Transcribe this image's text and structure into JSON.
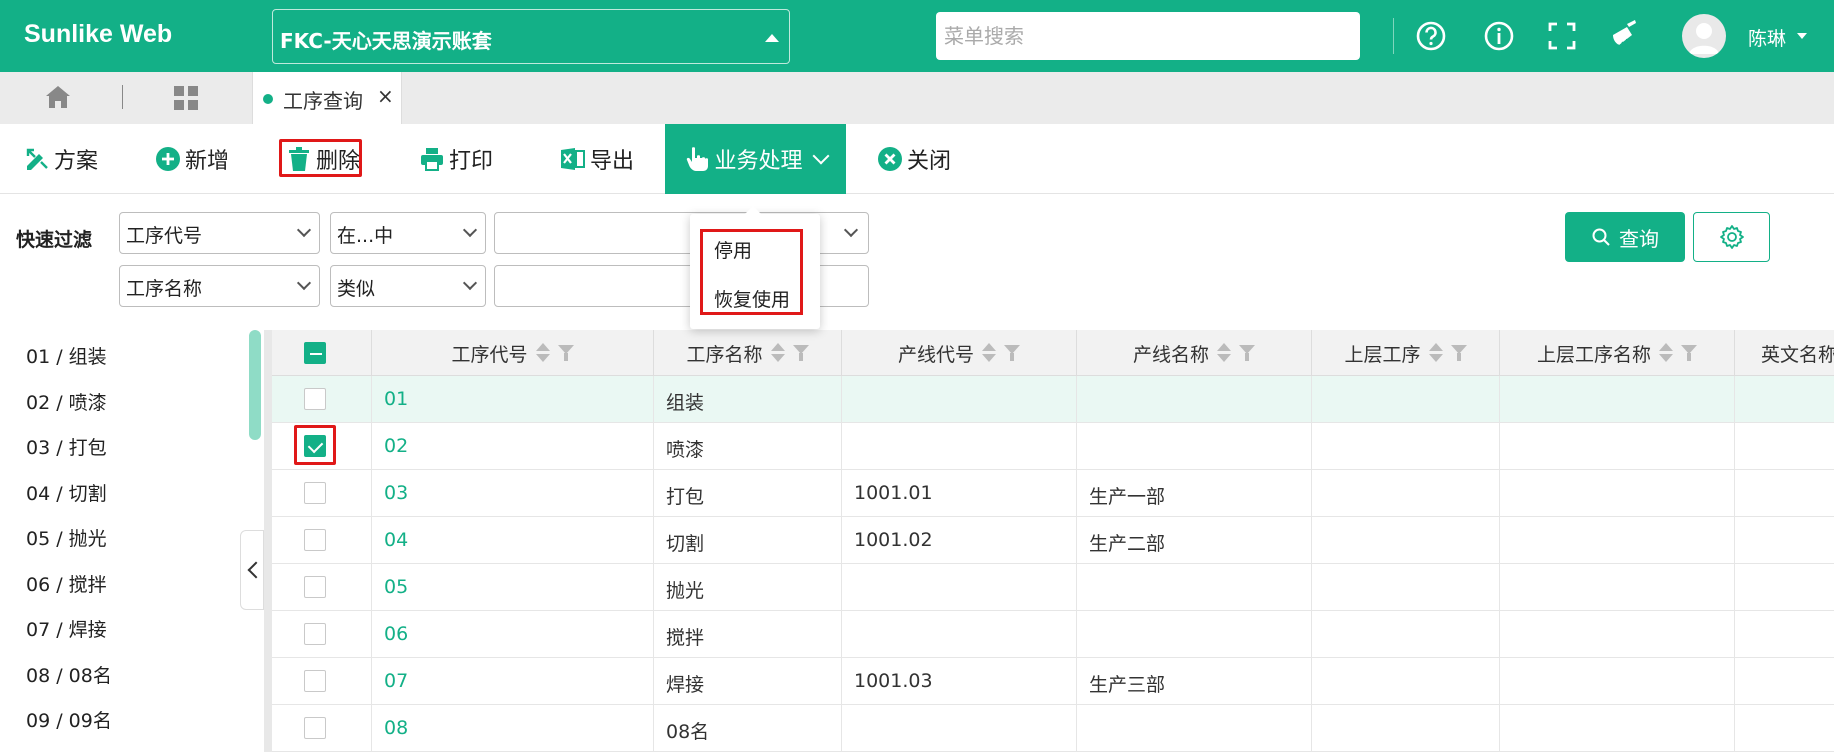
{
  "app": {
    "brand": "Sunlike Web",
    "account": "FKC-天心天思演示账套"
  },
  "search": {
    "placeholder": "菜单搜索"
  },
  "user": {
    "name": "陈琳"
  },
  "tabs": [
    {
      "label": "工序查询",
      "active": true
    }
  ],
  "toolbar": {
    "scheme": "方案",
    "add": "新增",
    "delete": "删除",
    "print": "打印",
    "export": "导出",
    "business": "业务处理",
    "close": "关闭"
  },
  "business_menu": {
    "items": [
      "停用",
      "恢复使用"
    ]
  },
  "filter": {
    "title": "快速过滤",
    "rows": [
      {
        "field": "工序代号",
        "operator": "在...中",
        "value": ""
      },
      {
        "field": "工序名称",
        "operator": "类似",
        "value": ""
      }
    ]
  },
  "query_button": "查询",
  "tree": [
    "01 / 组装",
    "02 / 喷漆",
    "03 / 打包",
    "04 / 切割",
    "05 / 抛光",
    "06 / 搅拌",
    "07 / 焊接",
    "08 / 08名",
    "09 / 09名"
  ],
  "grid": {
    "columns": [
      "工序代号",
      "工序名称",
      "产线代号",
      "产线名称",
      "上层工序",
      "上层工序名称",
      "英文名称"
    ],
    "rows": [
      {
        "code": "01",
        "name": "组装",
        "line_code": "",
        "line_name": "",
        "parent": "",
        "parent_name": "",
        "en": "",
        "checked": false,
        "highlight": true
      },
      {
        "code": "02",
        "name": "喷漆",
        "line_code": "",
        "line_name": "",
        "parent": "",
        "parent_name": "",
        "en": "",
        "checked": true,
        "highlight": false
      },
      {
        "code": "03",
        "name": "打包",
        "line_code": "1001.01",
        "line_name": "生产一部",
        "parent": "",
        "parent_name": "",
        "en": "",
        "checked": false,
        "highlight": false
      },
      {
        "code": "04",
        "name": "切割",
        "line_code": "1001.02",
        "line_name": "生产二部",
        "parent": "",
        "parent_name": "",
        "en": "",
        "checked": false,
        "highlight": false
      },
      {
        "code": "05",
        "name": "抛光",
        "line_code": "",
        "line_name": "",
        "parent": "",
        "parent_name": "",
        "en": "",
        "checked": false,
        "highlight": false
      },
      {
        "code": "06",
        "name": "搅拌",
        "line_code": "",
        "line_name": "",
        "parent": "",
        "parent_name": "",
        "en": "",
        "checked": false,
        "highlight": false
      },
      {
        "code": "07",
        "name": "焊接",
        "line_code": "1001.03",
        "line_name": "生产三部",
        "parent": "",
        "parent_name": "",
        "en": "",
        "checked": false,
        "highlight": false
      },
      {
        "code": "08",
        "name": "08名",
        "line_code": "",
        "line_name": "",
        "parent": "",
        "parent_name": "",
        "en": "",
        "checked": false,
        "highlight": false
      }
    ]
  },
  "colors": {
    "primary": "#13b087",
    "highlight_box": "#e01818",
    "row_highlight": "#eaf8f3"
  }
}
